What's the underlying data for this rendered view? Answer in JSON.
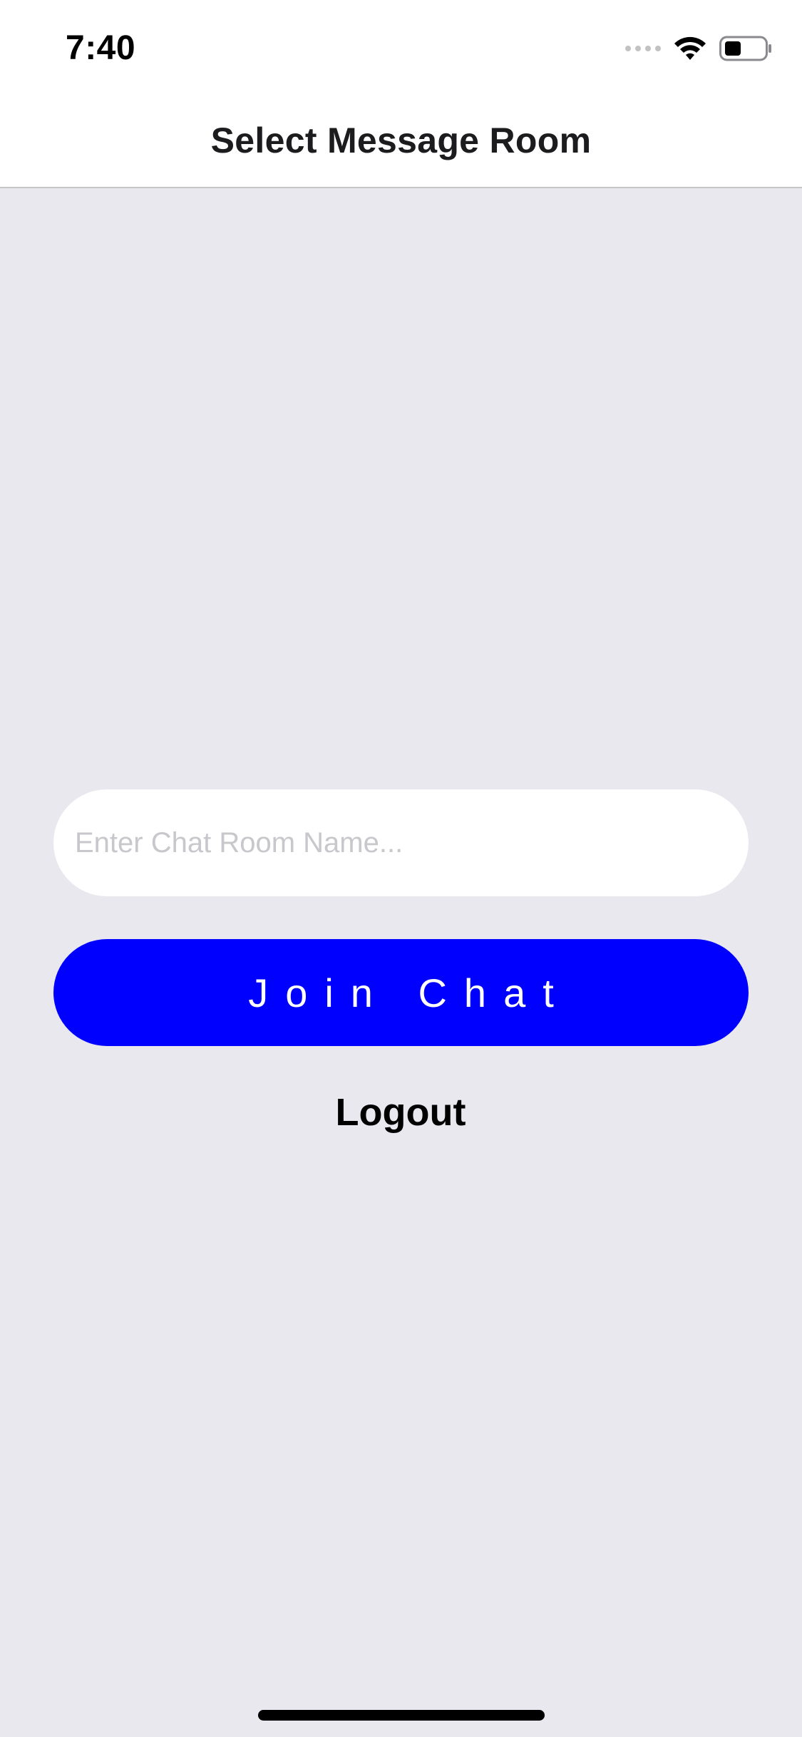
{
  "status_bar": {
    "time": "7:40",
    "icons": [
      "signal-icon",
      "wifi-icon",
      "battery-icon"
    ]
  },
  "nav": {
    "title": "Select Message Room"
  },
  "form": {
    "room_input": {
      "placeholder": "Enter Chat Room Name...",
      "value": ""
    },
    "join_label": "Join Chat",
    "logout_label": "Logout"
  },
  "colors": {
    "background": "#e9e8ef",
    "nav_background": "#ffffff",
    "join_button": "#0000ff",
    "join_text": "#ffffff",
    "placeholder": "#c7c7cc"
  }
}
